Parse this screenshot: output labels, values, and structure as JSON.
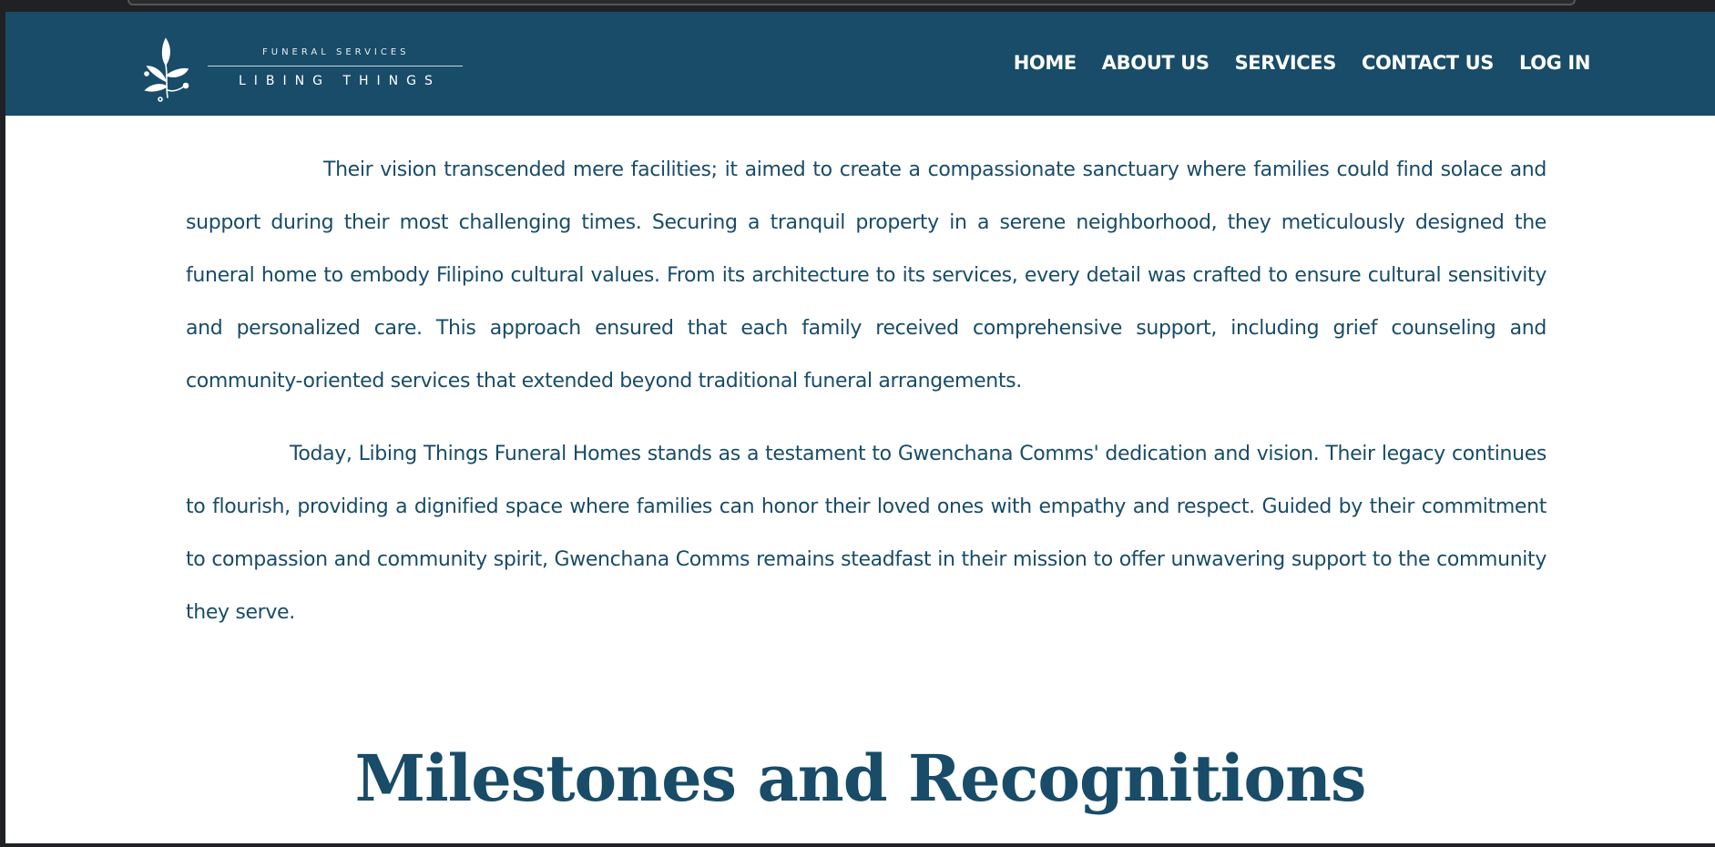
{
  "brand": {
    "tagline": "FUNERAL SERVICES",
    "name": "LIBING THINGS"
  },
  "nav": {
    "items": [
      {
        "label": "HOME"
      },
      {
        "label": "ABOUT US"
      },
      {
        "label": "SERVICES"
      },
      {
        "label": "CONTACT US"
      },
      {
        "label": "LOG IN"
      }
    ]
  },
  "content": {
    "paragraphs": [
      "Their vision transcended mere facilities; it aimed to create a compassionate sanctuary where families could find solace and support during their most challenging times. Securing a tranquil property in a serene neighborhood, they meticulously designed the funeral home to embody Filipino cultural values. From its architecture to its services, every detail was crafted to ensure cultural sensitivity and personalized care. This approach ensured that each family received comprehensive support, including grief counseling and community-oriented services that extended beyond traditional funeral arrangements.",
      "Today, Libing Things Funeral Homes stands as a testament to Gwenchana Comms' dedication and vision. Their legacy continues to flourish, providing a dignified space where families can honor their loved ones with empathy and respect. Guided by their commitment to compassion and community spirit, Gwenchana Comms remains steadfast in their mission to offer unwavering support to the community they serve."
    ],
    "section_heading": "Milestones and Recognitions"
  },
  "colors": {
    "primary": "#184c68",
    "background": "#ffffff",
    "nav_text": "#ffffff"
  },
  "icons": {
    "logo": "leaf-sprig-icon"
  }
}
